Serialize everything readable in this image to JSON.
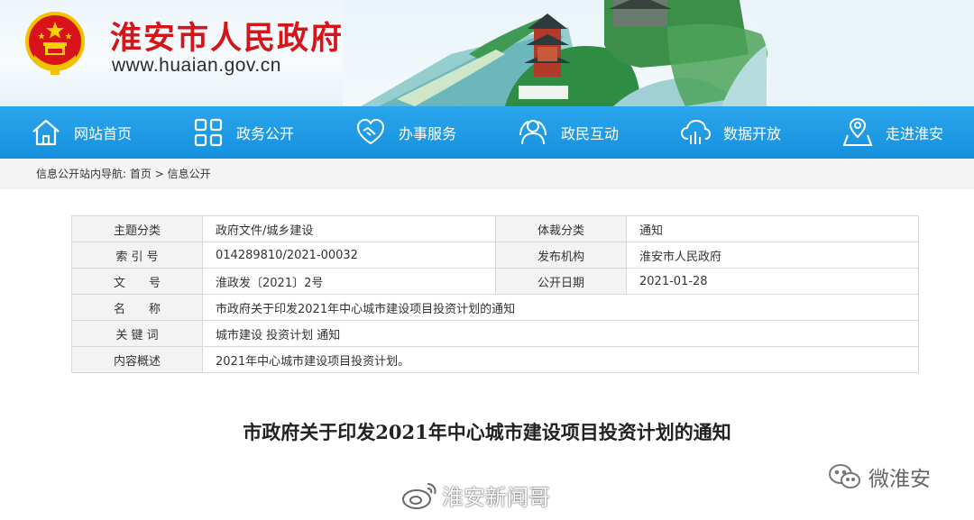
{
  "header": {
    "site_title": "淮安市人民政府",
    "site_url": "www.huaian.gov.cn"
  },
  "nav": {
    "items": [
      {
        "label": "网站首页",
        "icon": "home-icon"
      },
      {
        "label": "政务公开",
        "icon": "grid-icon"
      },
      {
        "label": "办事服务",
        "icon": "handshake-icon"
      },
      {
        "label": "政民互动",
        "icon": "people-icon"
      },
      {
        "label": "数据开放",
        "icon": "cloud-data-icon"
      },
      {
        "label": "走进淮安",
        "icon": "map-pin-icon"
      }
    ]
  },
  "breadcrumb": {
    "prefix": "信息公开站内导航:",
    "home": "首页",
    "separator": ">",
    "current": "信息公开"
  },
  "info": {
    "topic_label": "主题分类",
    "topic_value": "政府文件/城乡建设",
    "genre_label": "体裁分类",
    "genre_value": "通知",
    "index_label": "索 引 号",
    "index_value": "014289810/2021-00032",
    "publisher_label": "发布机构",
    "publisher_value": "淮安市人民政府",
    "docno_label": "文　　号",
    "docno_value": "淮政发〔2021〕2号",
    "date_label": "公开日期",
    "date_value": "2021-01-28",
    "name_label": "名　　称",
    "name_value": "市政府关于印发2021年中心城市建设项目投资计划的通知",
    "keywords_label": "关 键 词",
    "keywords_value": "城市建设 投资计划 通知",
    "summary_label": "内容概述",
    "summary_value": "2021年中心城市建设项目投资计划。"
  },
  "document": {
    "title": "市政府关于印发2021年中心城市建设项目投资计划的通知"
  },
  "watermarks": {
    "wechat": "微淮安",
    "weibo": "淮安新闻哥"
  },
  "colors": {
    "title_red": "#d4161a",
    "nav_blue": "#1e9be6"
  }
}
